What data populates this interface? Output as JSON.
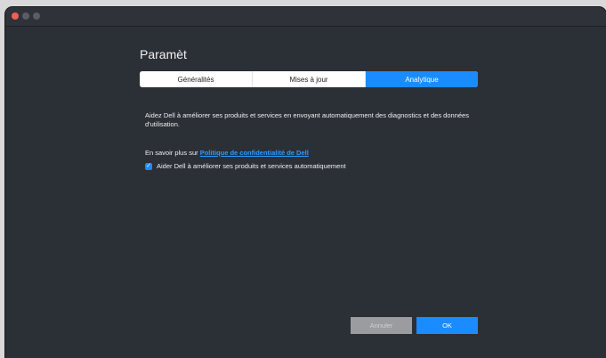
{
  "window": {
    "title": ""
  },
  "page": {
    "heading": "Paramèt"
  },
  "tabs": [
    {
      "label": "Généralités",
      "active": false
    },
    {
      "label": "Mises à jour",
      "active": false
    },
    {
      "label": "Analytique",
      "active": true
    }
  ],
  "analytics": {
    "description": "Aidez Dell à améliorer ses produits et services en envoyant automatiquement des diagnostics et des données d'utilisation.",
    "learn_more_prefix": "En savoir plus sur",
    "privacy_link": "Politique de confidentialité de Dell",
    "checkbox_label": "Aider Dell à améliorer ses produits et services automatiquement",
    "checkbox_checked": true
  },
  "buttons": {
    "cancel": "Annuler",
    "ok": "OK"
  },
  "colors": {
    "accent": "#1a8cff",
    "background": "#2b2f36",
    "link": "#2c9bff"
  }
}
